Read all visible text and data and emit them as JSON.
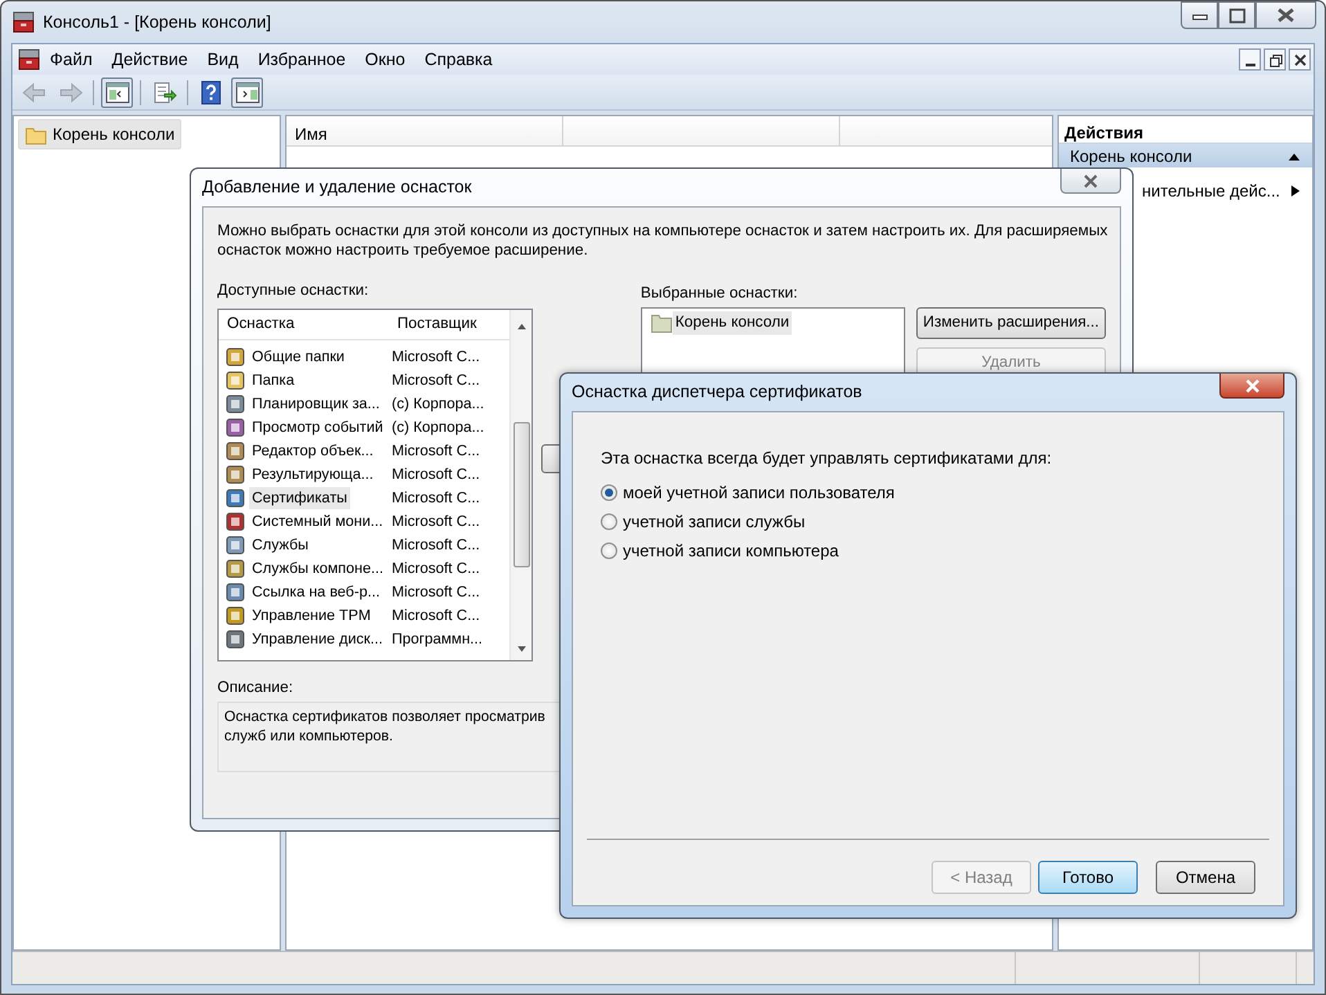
{
  "window": {
    "title": "Консоль1 - [Корень консоли]"
  },
  "menu": [
    "Файл",
    "Действие",
    "Вид",
    "Избранное",
    "Окно",
    "Справка"
  ],
  "toolbar": [
    {
      "kind": "back",
      "disabled": true
    },
    {
      "kind": "forward",
      "disabled": true
    },
    {
      "kind": "separator"
    },
    {
      "kind": "tree-toggle",
      "pressed": true
    },
    {
      "kind": "separator"
    },
    {
      "kind": "export",
      "pressed": false
    },
    {
      "kind": "separator"
    },
    {
      "kind": "help",
      "pressed": false
    },
    {
      "kind": "action-pane-toggle",
      "pressed": true
    }
  ],
  "tree": [
    {
      "label": "Корень консоли",
      "selected": true
    }
  ],
  "list_view": {
    "columns": [
      "Имя"
    ]
  },
  "actions_pane": {
    "title": "Действия",
    "section": "Корень консоли",
    "items": [
      {
        "label": "нительные дейс...",
        "submenu": true
      }
    ]
  },
  "snapin_dialog": {
    "title": "Добавление и удаление оснасток",
    "intro": "Можно выбрать оснастки для этой консоли из доступных на компьютере оснасток и затем настроить их. Для расширяемых оснасток можно настроить требуемое расширение.",
    "available_label": "Доступные оснастки:",
    "columns": [
      "Оснастка",
      "Поставщик"
    ],
    "rows": [
      {
        "name": "Общие папки",
        "vendor": "Microsoft C...",
        "selected": false
      },
      {
        "name": "Папка",
        "vendor": "Microsoft C...",
        "selected": false
      },
      {
        "name": "Планировщик за...",
        "vendor": "(c) Корпора...",
        "selected": false
      },
      {
        "name": "Просмотр событий",
        "vendor": "(c) Корпора...",
        "selected": false
      },
      {
        "name": "Редактор объек...",
        "vendor": "Microsoft C...",
        "selected": false
      },
      {
        "name": "Результирующа...",
        "vendor": "Microsoft C...",
        "selected": false
      },
      {
        "name": "Сертификаты",
        "vendor": "Microsoft C...",
        "selected": true
      },
      {
        "name": "Системный мони...",
        "vendor": "Microsoft C...",
        "selected": false
      },
      {
        "name": "Службы",
        "vendor": "Microsoft C...",
        "selected": false
      },
      {
        "name": "Службы компоне...",
        "vendor": "Microsoft C...",
        "selected": false
      },
      {
        "name": "Ссылка на веб-р...",
        "vendor": "Microsoft C...",
        "selected": false
      },
      {
        "name": "Управление TPM",
        "vendor": "Microsoft C...",
        "selected": false
      },
      {
        "name": "Управление диск...",
        "vendor": "Программн...",
        "selected": false
      }
    ],
    "selected_label": "Выбранные оснастки:",
    "selected_items": [
      {
        "label": "Корень консоли",
        "selected": true
      }
    ],
    "buttons": [
      {
        "label": "Изменить расширения...",
        "disabled": false
      },
      {
        "label": "Удалить",
        "disabled": true
      }
    ],
    "description_label": "Описание:",
    "description_lines": [
      "Оснастка сертификатов позволяет просматрив",
      "служб или компьютеров."
    ]
  },
  "cert_dialog": {
    "title": "Оснастка диспетчера сертификатов",
    "prompt": "Эта оснастка всегда будет управлять сертификатами для:",
    "options": [
      {
        "label": "моей учетной записи пользователя",
        "selected": true
      },
      {
        "label": "учетной записи службы",
        "selected": false
      },
      {
        "label": "учетной записи компьютера",
        "selected": false
      }
    ],
    "buttons": [
      {
        "label": "< Назад",
        "disabled": true,
        "default": false
      },
      {
        "label": "Готово",
        "disabled": false,
        "default": true
      },
      {
        "label": "Отмена",
        "disabled": false,
        "default": false
      }
    ]
  }
}
